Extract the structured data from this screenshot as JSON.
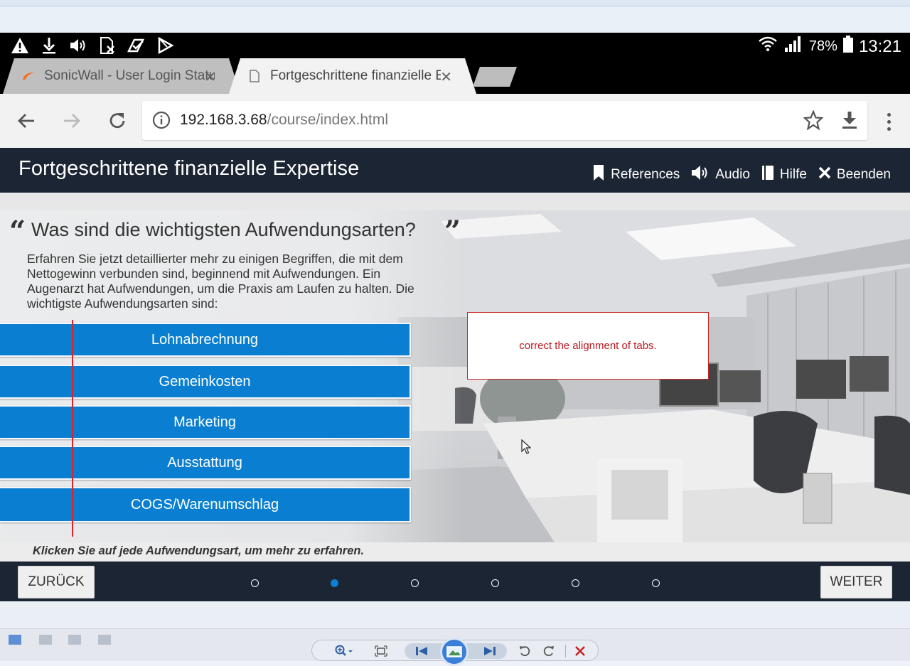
{
  "status_bar": {
    "battery_pct": "78%",
    "time": "13:21"
  },
  "tabs": [
    {
      "label": "SonicWall - User Login Status"
    },
    {
      "label": "Fortgeschrittene finanzielle Expertise"
    }
  ],
  "omnibox": {
    "host": "192.168.3.68",
    "path": "/course/index.html"
  },
  "course": {
    "title": "Fortgeschrittene finanzielle Expertise",
    "nav": [
      {
        "label": "References"
      },
      {
        "label": "Audio"
      },
      {
        "label": "Hilfe"
      },
      {
        "label": "Beenden"
      }
    ],
    "question": "Was sind die wichtigsten Aufwendungsarten?",
    "paragraph": "Erfahren Sie jetzt detaillierter mehr zu einigen Begriffen, die mit dem Nettogewinn verbunden sind, beginnend mit Aufwendungen. Ein Augenarzt hat Aufwendungen, um die Praxis am Laufen zu halten. Die wichtigste Aufwendungsarten sind:",
    "expense_tabs": [
      {
        "label": "Lohnabrechnung"
      },
      {
        "label": "Gemeinkosten"
      },
      {
        "label": "Marketing"
      },
      {
        "label": "Ausstattung"
      },
      {
        "label": "COGS/Warenumschlag"
      }
    ],
    "annotation_note": "correct the alignment of tabs.",
    "instruction": "Klicken Sie auf jede Aufwendungsart, um mehr zu erfahren.",
    "back_label": "ZURÜCK",
    "next_label": "WEITER",
    "progress": {
      "total_pages": 6,
      "current_page": 2
    }
  },
  "colors": {
    "header_bg": "#1b2533",
    "tab_blue": "#0a7fd1",
    "annotation_red": "#cc2222"
  }
}
